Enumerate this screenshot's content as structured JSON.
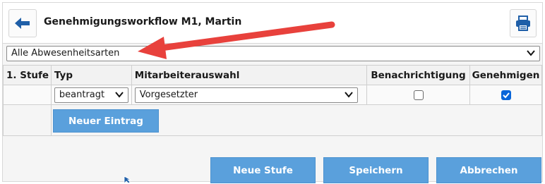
{
  "header": {
    "title": "Genehmigungsworkflow M1, Martin",
    "back_icon": "arrow-left-icon",
    "print_icon": "printer-icon"
  },
  "absence_filter": {
    "selected": "Alle Abwesenheitsarten"
  },
  "table": {
    "columns": [
      "1. Stufe",
      "Typ",
      "Mitarbeiterauswahl",
      "Benachrichtigung",
      "Genehmigen"
    ],
    "rows": [
      {
        "typ": "beantragt",
        "mitarbeiterauswahl": "Vorgesetzter",
        "benachrichtigung": false,
        "genehmigen": true
      }
    ],
    "new_entry_label": "Neuer Eintrag"
  },
  "footer": {
    "new_stage_label": "Neue Stufe",
    "save_label": "Speichern",
    "cancel_label": "Abbrechen"
  },
  "colors": {
    "accent_button": "#5aa0dc",
    "annotation_arrow": "#e8413c",
    "checkbox_checked": "#0a66d9",
    "back_arrow": "#1f5fa8"
  }
}
